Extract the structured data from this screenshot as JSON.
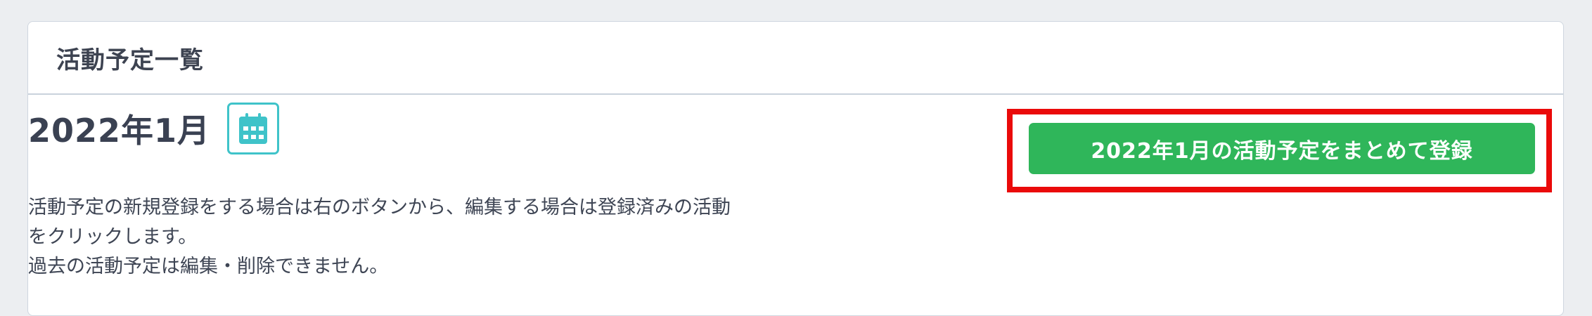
{
  "card": {
    "title": "活動予定一覧"
  },
  "month": {
    "title": "2022年1月",
    "calendar_icon": "calendar-icon"
  },
  "actions": {
    "bulk_register_label": "2022年1月の活動予定をまとめて登録"
  },
  "description": {
    "lines": [
      "活動予定の新規登録をする場合は右のボタンから、編集する場合は登録済みの活動",
      "をクリックします。",
      "過去の活動予定は編集・削除できません。"
    ]
  },
  "colors": {
    "accent_teal": "#3fc3c9",
    "button_green": "#2fb65a",
    "highlight_red": "#ea0a0a"
  }
}
